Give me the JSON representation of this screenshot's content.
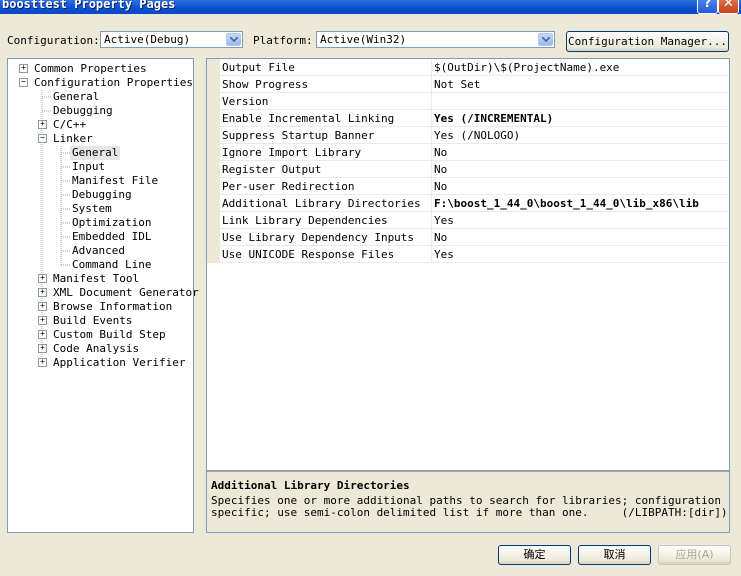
{
  "window": {
    "title": "boosttest Property Pages",
    "help_glyph": "?",
    "close_glyph": "✕"
  },
  "toolbar": {
    "configuration_label": "Configuration:",
    "configuration_value": "Active(Debug)",
    "platform_label": "Platform:",
    "platform_value": "Active(Win32)",
    "config_manager_button": "Configuration Manager..."
  },
  "tree": [
    {
      "label": "Common Properties",
      "expander": "+",
      "selected": false
    },
    {
      "label": "Configuration Properties",
      "expander": "−",
      "selected": false
    },
    {
      "label": "General",
      "expander": "",
      "selected": false
    },
    {
      "label": "Debugging",
      "expander": "",
      "selected": false
    },
    {
      "label": "C/C++",
      "expander": "+",
      "selected": false
    },
    {
      "label": "Linker",
      "expander": "−",
      "selected": false
    },
    {
      "label": "General",
      "expander": "",
      "selected": true
    },
    {
      "label": "Input",
      "expander": "",
      "selected": false
    },
    {
      "label": "Manifest File",
      "expander": "",
      "selected": false
    },
    {
      "label": "Debugging",
      "expander": "",
      "selected": false
    },
    {
      "label": "System",
      "expander": "",
      "selected": false
    },
    {
      "label": "Optimization",
      "expander": "",
      "selected": false
    },
    {
      "label": "Embedded IDL",
      "expander": "",
      "selected": false
    },
    {
      "label": "Advanced",
      "expander": "",
      "selected": false
    },
    {
      "label": "Command Line",
      "expander": "",
      "selected": false
    },
    {
      "label": "Manifest Tool",
      "expander": "+",
      "selected": false
    },
    {
      "label": "XML Document Generator",
      "expander": "+",
      "selected": false
    },
    {
      "label": "Browse Information",
      "expander": "+",
      "selected": false
    },
    {
      "label": "Build Events",
      "expander": "+",
      "selected": false
    },
    {
      "label": "Custom Build Step",
      "expander": "+",
      "selected": false
    },
    {
      "label": "Code Analysis",
      "expander": "+",
      "selected": false
    },
    {
      "label": "Application Verifier",
      "expander": "+",
      "selected": false
    }
  ],
  "properties": [
    {
      "name": "Output File",
      "value": "$(OutDir)\\$(ProjectName).exe",
      "bold": false
    },
    {
      "name": "Show Progress",
      "value": "Not Set",
      "bold": false
    },
    {
      "name": "Version",
      "value": "",
      "bold": false
    },
    {
      "name": "Enable Incremental Linking",
      "value": "Yes (/INCREMENTAL)",
      "bold": true
    },
    {
      "name": "Suppress Startup Banner",
      "value": "Yes (/NOLOGO)",
      "bold": false
    },
    {
      "name": "Ignore Import Library",
      "value": "No",
      "bold": false
    },
    {
      "name": "Register Output",
      "value": "No",
      "bold": false
    },
    {
      "name": "Per-user Redirection",
      "value": "No",
      "bold": false
    },
    {
      "name": "Additional Library Directories",
      "value": "F:\\boost_1_44_0\\boost_1_44_0\\lib_x86\\lib",
      "bold": true
    },
    {
      "name": "Link Library Dependencies",
      "value": "Yes",
      "bold": false
    },
    {
      "name": "Use Library Dependency Inputs",
      "value": "No",
      "bold": false
    },
    {
      "name": "Use UNICODE Response Files",
      "value": "Yes",
      "bold": false
    }
  ],
  "description": {
    "title": "Additional Library Directories",
    "line1": "Specifies one or more additional paths to search for libraries; configuration",
    "line2": "specific; use semi-colon delimited list if more than one.     (/LIBPATH:[dir])"
  },
  "buttons": {
    "ok": "确定",
    "cancel": "取消",
    "apply": "应用(A)"
  }
}
